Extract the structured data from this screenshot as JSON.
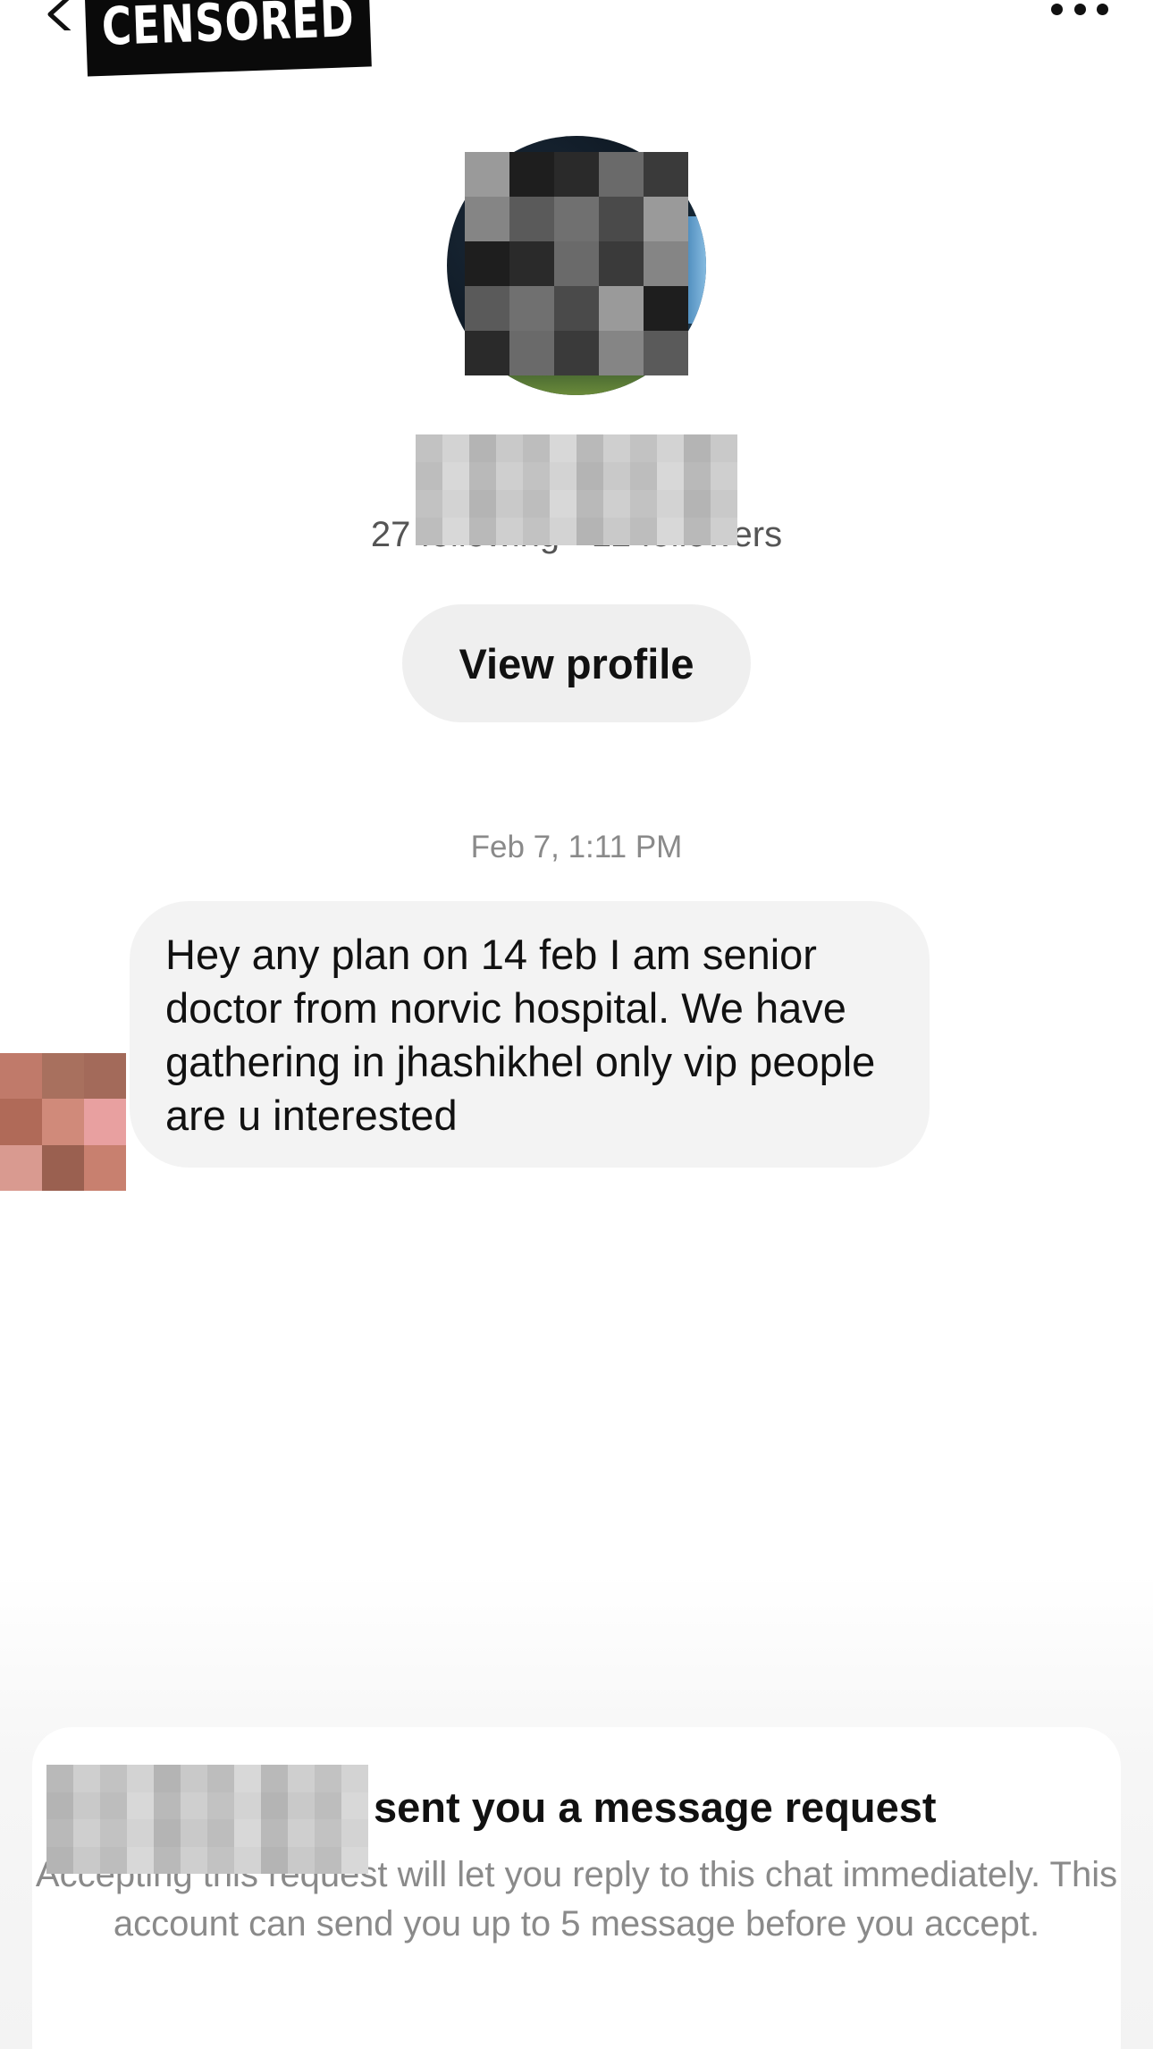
{
  "header": {
    "censor_label": "CENSORED"
  },
  "profile": {
    "following": "27 following",
    "followers": "12 followers",
    "stats_separator": "·",
    "view_profile_label": "View profile"
  },
  "conversation": {
    "timestamp": "Feb 7, 1:11 PM",
    "message": "Hey any plan on 14 feb I am senior doctor from norvic hospital. We have gathering in jhashikhel only vip people are u interested"
  },
  "request": {
    "title": "sent you a message request",
    "description": "Accepting this request will let you reply to this chat immediately. This account can send you up to 5 message before you accept."
  },
  "colors": {
    "bubble_bg": "#f3f3f3",
    "button_bg": "#efefef",
    "muted_text": "#8a8a8a"
  },
  "icons": {
    "back": "chevron-left-icon",
    "more": "more-horizontal-icon"
  }
}
